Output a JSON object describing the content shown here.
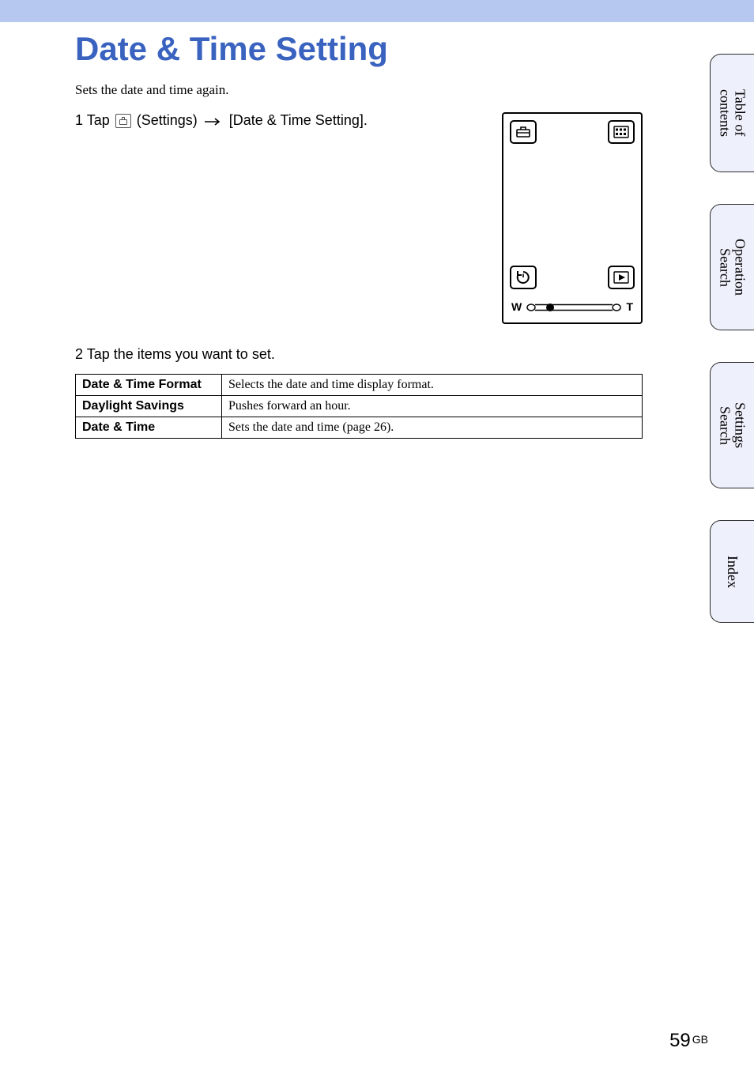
{
  "title": "Date & Time Setting",
  "intro": "Sets the date and time again.",
  "step1": {
    "number": "1",
    "prefix": "Tap ",
    "settings_label": " (Settings) ",
    "target": " [Date & Time Setting]."
  },
  "figure": {
    "zoom_w": "W",
    "zoom_t": "T"
  },
  "step2": {
    "number": "2",
    "text": "Tap the items you want to set."
  },
  "table": [
    {
      "key": "Date & Time Format",
      "desc": "Selects the date and time display format."
    },
    {
      "key": "Daylight Savings",
      "desc": "Pushes forward an hour."
    },
    {
      "key": "Date & Time",
      "desc": "Sets the date and time (page 26)."
    }
  ],
  "tabs": {
    "toc": "Table of\ncontents",
    "op": "Operation\nSearch",
    "settings": "Settings\nSearch",
    "index": "Index"
  },
  "page": {
    "num": "59",
    "suffix": "GB"
  }
}
